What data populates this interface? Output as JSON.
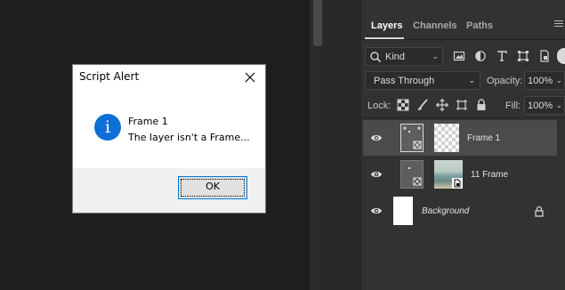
{
  "canvas": {},
  "panel": {
    "tabs": [
      {
        "label": "Layers",
        "active": true
      },
      {
        "label": "Channels",
        "active": false
      },
      {
        "label": "Paths",
        "active": false
      }
    ],
    "filter": {
      "kind_label": "Kind"
    },
    "blend": {
      "mode": "Pass Through",
      "opacity_label": "Opacity:",
      "opacity_value": "100%"
    },
    "lock": {
      "lock_label": "Lock:",
      "fill_label": "Fill:",
      "fill_value": "100%"
    },
    "layers": [
      {
        "name": "Frame 1",
        "selected": true
      },
      {
        "name": "11 Frame",
        "selected": false
      },
      {
        "name": "Background",
        "selected": false,
        "locked": true
      }
    ]
  },
  "dialog": {
    "title": "Script Alert",
    "message_line1": "Frame 1",
    "message_line2": "The layer isn't a Frame...",
    "ok_label": "OK",
    "icon": "info-icon"
  },
  "colors": {
    "accent": "#0e6fd6",
    "panel_bg": "#323232",
    "selected_layer_bg": "#4b4b4b"
  }
}
